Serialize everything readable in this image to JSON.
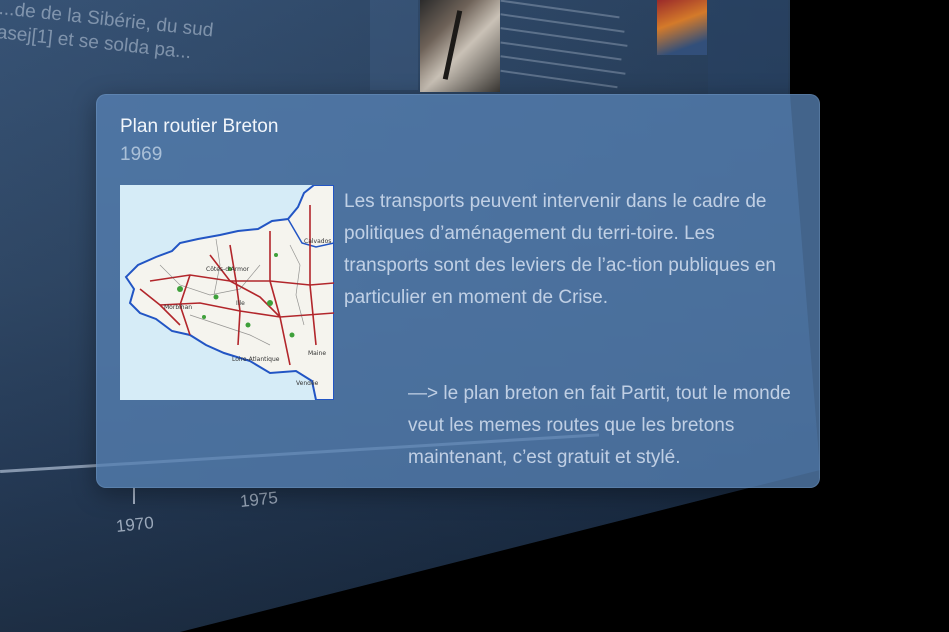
{
  "background": {
    "text_lines": [
      "...de de la Sibérie, du sud",
      "asej[1] et se solda pa..."
    ],
    "axis_years": [
      "1970",
      "1975"
    ]
  },
  "card": {
    "title": "Plan routier Breton",
    "date": "1969",
    "body": "Les transports peuvent intervenir dans le cadre de politiques d’aménagement du terri-toire. Les transports sont des leviers de l’ac-tion publiques en particulier en moment de Crise.",
    "body_continuation": "—> le plan breton en fait Partit, tout le monde veut les memes routes que les bretons maintenant, c’est gratuit et stylé."
  },
  "colors": {
    "card_background": "#5680b2",
    "wall": "#27405f",
    "map_sea": "#d6ecf7",
    "map_roads": "#b2262b",
    "map_coast": "#2255c4"
  },
  "icons": [
    "map-thumbnail"
  ]
}
